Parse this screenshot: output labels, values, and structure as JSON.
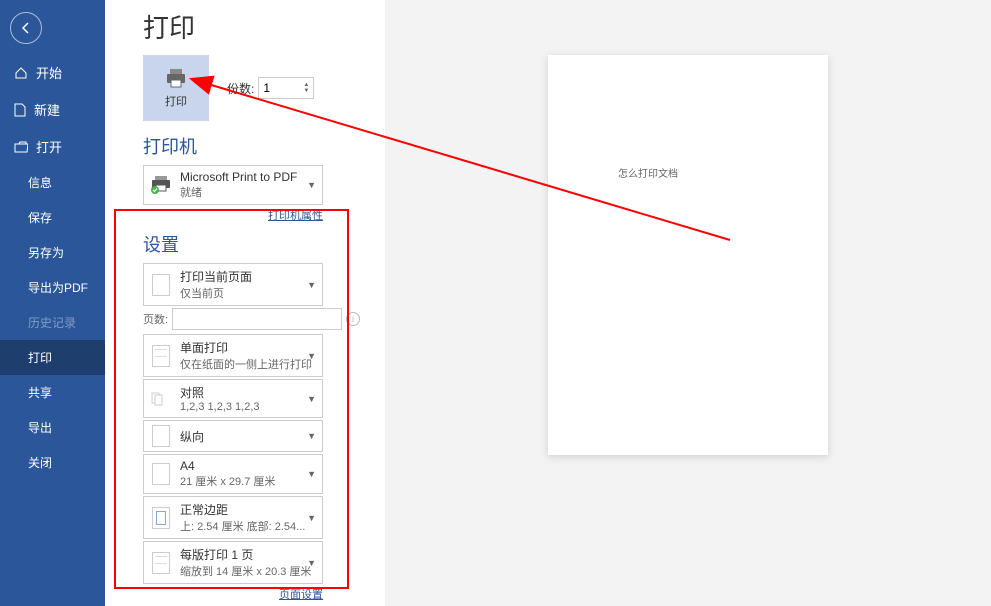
{
  "sidebar": {
    "items": [
      {
        "label": "开始",
        "icon": "home"
      },
      {
        "label": "新建",
        "icon": "file"
      },
      {
        "label": "打开",
        "icon": "open"
      },
      {
        "label": "信息",
        "indent": true
      },
      {
        "label": "保存",
        "indent": true
      },
      {
        "label": "另存为",
        "indent": true
      },
      {
        "label": "导出为PDF",
        "indent": true
      },
      {
        "label": "历史记录",
        "indent": true,
        "disabled": true
      },
      {
        "label": "打印",
        "indent": true,
        "active": true
      },
      {
        "label": "共享",
        "indent": true
      },
      {
        "label": "导出",
        "indent": true
      },
      {
        "label": "关闭",
        "indent": true
      }
    ]
  },
  "page_title": "打印",
  "print_button_label": "打印",
  "copies": {
    "label": "份数:",
    "value": "1"
  },
  "printer_section": {
    "title": "打印机",
    "selected": {
      "name": "Microsoft Print to PDF",
      "status": "就绪"
    },
    "properties_link": "打印机属性"
  },
  "settings_section": {
    "title": "设置",
    "print_range": {
      "main": "打印当前页面",
      "sub": "仅当前页"
    },
    "pages": {
      "label": "页数:",
      "value": ""
    },
    "sides": {
      "main": "单面打印",
      "sub": "仅在纸面的一侧上进行打印"
    },
    "collation": {
      "main": "对照",
      "sub": "1,2,3    1,2,3    1,2,3"
    },
    "orientation": {
      "main": "纵向",
      "sub": ""
    },
    "paper": {
      "main": "A4",
      "sub": "21 厘米 x 29.7 厘米"
    },
    "margins": {
      "main": "正常边距",
      "sub": "上: 2.54 厘米 底部: 2.54..."
    },
    "pages_per_sheet": {
      "main": "每版打印 1 页",
      "sub": "缩放到 14 厘米 x 20.3 厘米"
    },
    "page_setup_link": "页面设置"
  },
  "preview_text": "怎么打印文档"
}
